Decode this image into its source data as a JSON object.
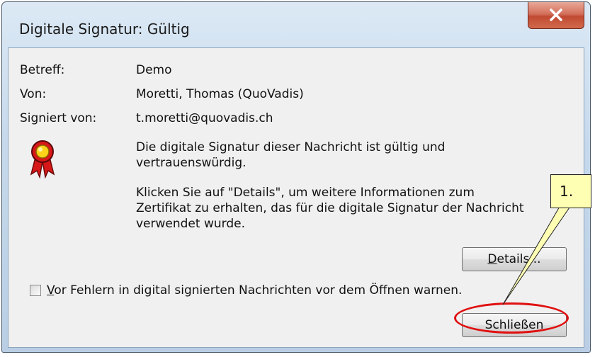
{
  "window": {
    "title": "Digitale Signatur: Gültig",
    "close_icon": "close-icon"
  },
  "fields": {
    "subject_label": "Betreff:",
    "subject_value": "Demo",
    "from_label": "Von:",
    "from_value": "Moretti, Thomas (QuoVadis)",
    "signed_by_label": "Signiert von:",
    "signed_by_value": "t.moretti@quovadis.ch"
  },
  "message": {
    "icon": "certificate-seal-icon",
    "line1": "Die digitale Signatur dieser Nachricht ist gültig und",
    "line2": "vertrauenswürdig.",
    "line3": "Klicken Sie auf \"Details\", um weitere Informationen zum",
    "line4": "Zertifikat zu erhalten, das für die digitale Signatur der Nachricht",
    "line5": "verwendet wurde."
  },
  "buttons": {
    "details_mnemonic": "D",
    "details_rest": "etails...",
    "close": "Schließen"
  },
  "checkbox": {
    "mnemonic": "V",
    "label_rest": "or Fehlern in digital signierten Nachrichten vor dem Öffnen warnen.",
    "checked": false
  },
  "annotation": {
    "callout_label": "1.",
    "highlight_color": "#e01010",
    "callout_fill": "#ffffb4"
  }
}
